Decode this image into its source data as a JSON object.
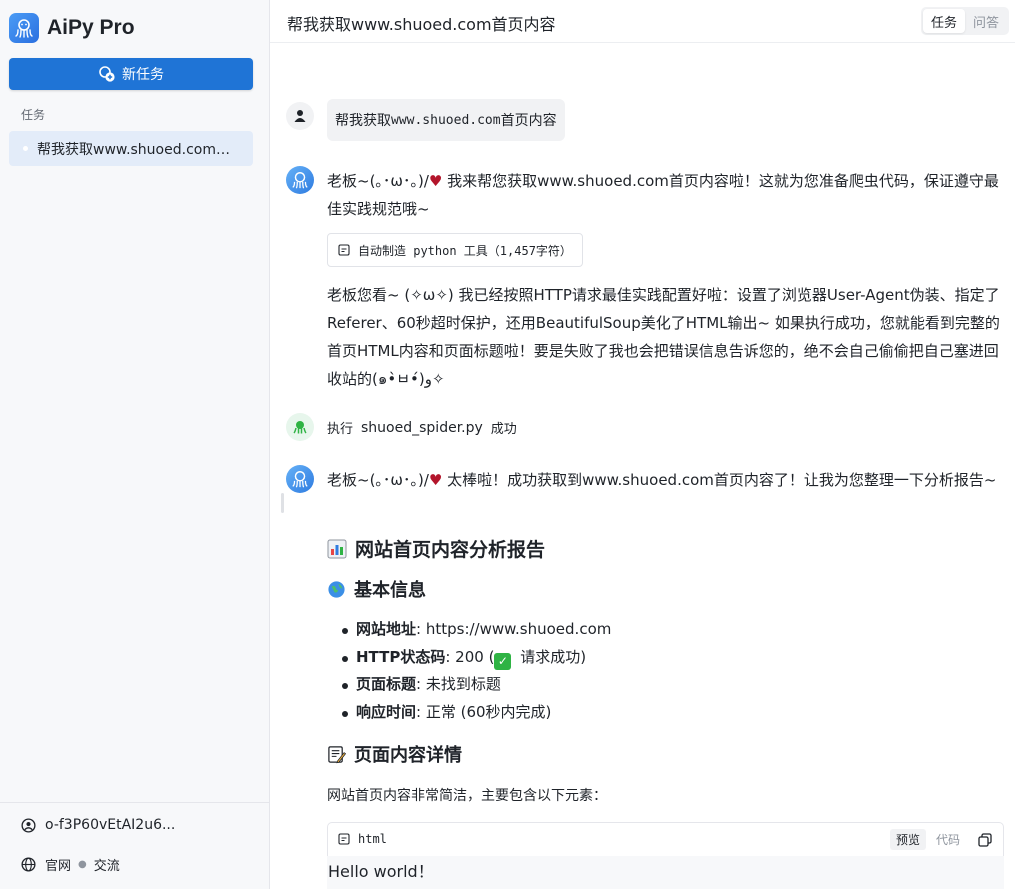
{
  "app": {
    "name": "AiPy Pro"
  },
  "sidebar": {
    "new_task_label": "新任务",
    "section_label": "任务",
    "tasks": [
      {
        "label": "帮我获取www.shuoed.com首..."
      }
    ],
    "user_id": "o-f3P60vEtAI2u6...",
    "links": {
      "official": "官网",
      "exchange": "交流"
    }
  },
  "header": {
    "title": "帮我获取www.shuoed.com首页内容",
    "tabs": [
      {
        "label": "任务",
        "active": true
      },
      {
        "label": "问答",
        "active": false
      }
    ]
  },
  "chat": {
    "user_prefix": "帮我获取",
    "user_mono": "www.shuoed.com",
    "user_suffix": "首页内容",
    "bot1_pre": "老板~(｡･ω･｡)/",
    "bot1_post": " 我来帮您获取www.shuoed.com首页内容啦！这就为您准备爬虫代码，保证遵守最佳实践规范哦~",
    "tool_chip": "自动制造 python 工具（1,457字符）",
    "bot2": "老板您看~ (✧ω✧) 我已经按照HTTP请求最佳实践配置好啦：设置了浏览器User-Agent伪装、指定了Referer、60秒超时保护，还用BeautifulSoup美化了HTML输出~ 如果执行成功，您就能看到完整的首页HTML内容和页面标题啦！要是失败了我也会把错误信息告诉您的，绝不会自己偷偷把自己塞进回收站的(๑•̀ㅂ•́)و✧",
    "exec_prefix": "执行",
    "exec_file": "shuoed_spider.py",
    "exec_status": "成功",
    "bot3_pre": "老板~(｡･ω･｡)/",
    "bot3_post": " 太棒啦！成功获取到www.shuoed.com首页内容了！让我为您整理一下分析报告~",
    "report_title": "网站首页内容分析报告",
    "basic_title": "基本信息",
    "info": [
      {
        "key": "网站地址",
        "value": ": https://www.shuoed.com"
      },
      {
        "key": "HTTP状态码",
        "value_pre": ": 200 (",
        "value_post": " 请求成功)"
      },
      {
        "key": "页面标题",
        "value": ": 未找到标题"
      },
      {
        "key": "响应时间",
        "value": ": 正常 (60秒内完成)"
      }
    ],
    "detail_title": "页面内容详情",
    "detail_text": "网站首页内容非常简洁，主要包含以下元素：",
    "code": {
      "lang": "html",
      "tab_preview": "预览",
      "tab_code": "代码",
      "content": "Hello world！"
    }
  },
  "colors": {
    "primary": "#1f74d6",
    "selected_task_bg": "#e3ecf9",
    "success": "#2fb344",
    "heart": "#b3152b"
  }
}
